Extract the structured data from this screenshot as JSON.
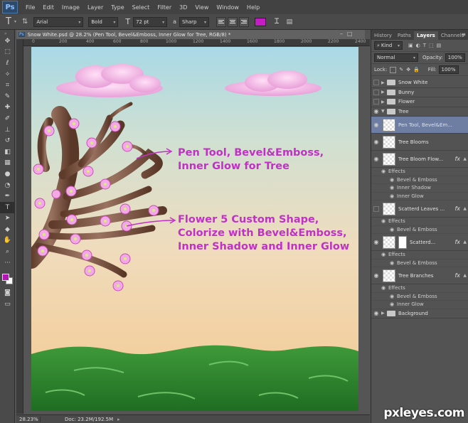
{
  "app": {
    "logo": "Ps"
  },
  "menu": [
    "File",
    "Edit",
    "Image",
    "Layer",
    "Type",
    "Select",
    "Filter",
    "3D",
    "View",
    "Window",
    "Help"
  ],
  "options": {
    "tool_icon": "T",
    "font_family": "Arial",
    "font_style": "Bold",
    "size_icon": "T",
    "font_size": "72 pt",
    "aa_icon": "a",
    "antialias": "Sharp",
    "text_color": "#c41dc4"
  },
  "document": {
    "tab_title": "Snow White.psd @ 28.2% (Pen Tool, Bevel&Emboss, Inner Glow for Tree, RGB/8) *",
    "ruler_top": [
      "0",
      "200",
      "400",
      "600",
      "800",
      "1000",
      "1200",
      "1400",
      "1600",
      "1800",
      "2000",
      "2200",
      "2400"
    ],
    "annotation1": [
      "Pen Tool, Bevel&Emboss,",
      "Inner Glow for Tree"
    ],
    "annotation2": [
      "Flower 5 Custom Shape,",
      "Colorize with Bevel&Emboss,",
      "Inner Shadow and Inner Glow"
    ],
    "annotation_color": "#c131c6",
    "zoom": "28.23%",
    "doc_size": "Doc: 23.2M/192.5M"
  },
  "toolbar": {
    "foreground": "#b515b5",
    "background": "#ffffff",
    "tools": [
      "move-icon",
      "marquee-icon",
      "lasso-icon",
      "quick-select-icon",
      "crop-icon",
      "eyedropper-icon",
      "healing-icon",
      "brush-icon",
      "stamp-icon",
      "history-brush-icon",
      "eraser-icon",
      "gradient-icon",
      "blur-icon",
      "dodge-icon",
      "pen-icon",
      "type-icon",
      "path-select-icon",
      "shape-icon",
      "hand-icon",
      "zoom-icon"
    ]
  },
  "panel": {
    "tabs": [
      "History",
      "Paths",
      "Layers",
      "Channels"
    ],
    "active_tab": "Layers",
    "filter_kind": "Kind",
    "blend_mode": "Normal",
    "opacity_label": "Opacity:",
    "opacity": "100%",
    "lock_label": "Lock:",
    "fill_label": "Fill:",
    "fill": "100%",
    "layers": [
      {
        "name": "Snow White",
        "type": "group",
        "visible": false,
        "level": 0
      },
      {
        "name": "Bunny",
        "type": "group",
        "visible": false,
        "level": 0
      },
      {
        "name": "Flower",
        "type": "group",
        "visible": false,
        "level": 0
      },
      {
        "name": "Tree",
        "type": "group",
        "visible": true,
        "level": 0,
        "open": true
      },
      {
        "name": "Pen Tool, Bevel&Em...",
        "type": "layer",
        "visible": true,
        "level": 1,
        "selected": true
      },
      {
        "name": "Tree Blooms",
        "type": "layer",
        "visible": true,
        "level": 1
      },
      {
        "name": "Tree Bloom Flow...",
        "type": "layer",
        "visible": true,
        "level": 1,
        "fx": true,
        "effects": [
          "Bevel & Emboss",
          "Inner Shadow",
          "Inner Glow"
        ]
      },
      {
        "name": "Scatterd Leaves ...",
        "type": "layer",
        "visible": false,
        "level": 1,
        "fx": true,
        "effects": [
          "Bevel & Emboss"
        ]
      },
      {
        "name": "Scatterd...",
        "type": "masked",
        "visible": true,
        "level": 1,
        "fx": true,
        "effects": [
          "Bevel & Emboss"
        ]
      },
      {
        "name": "Tree Branches",
        "type": "layer",
        "visible": true,
        "level": 1,
        "fx": true,
        "effects": [
          "Bevel & Emboss",
          "Inner Glow"
        ]
      },
      {
        "name": "Background",
        "type": "group",
        "visible": true,
        "level": 0
      }
    ],
    "effects_label": "Effects",
    "fx_label": "fx"
  },
  "watermark": "pxleyes.com"
}
